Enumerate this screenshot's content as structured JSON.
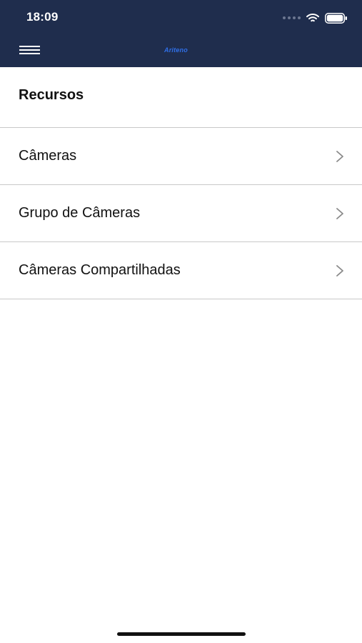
{
  "status_bar": {
    "time": "18:09"
  },
  "header": {
    "menu_icon": "hamburger-icon",
    "logo_text": "Ariteno"
  },
  "page": {
    "section_title": "Recursos"
  },
  "list": {
    "items": [
      {
        "label": "Câmeras",
        "icon": "chevron-right-icon"
      },
      {
        "label": "Grupo de Câmeras",
        "icon": "chevron-right-icon"
      },
      {
        "label": "Câmeras Compartilhadas",
        "icon": "chevron-right-icon"
      }
    ]
  },
  "colors": {
    "header_bg": "#1f2d4d",
    "logo": "#2f6fe8",
    "divider": "#c8c8c8"
  }
}
